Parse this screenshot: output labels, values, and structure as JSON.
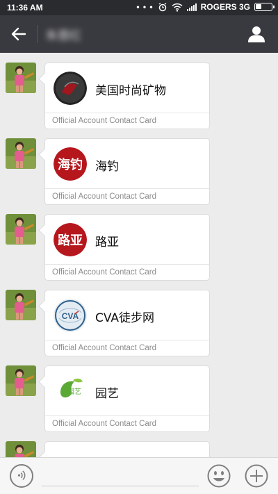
{
  "status_bar": {
    "time": "11:36 AM",
    "indicators": "• • •",
    "carrier": "ROGERS 3G",
    "icons": [
      "alarm-icon",
      "wifi-icon",
      "signal-icon",
      "battery-icon"
    ]
  },
  "header": {
    "title": "朱蓉红",
    "back_icon": "back-arrow-icon",
    "contact_icon": "contact-info-icon"
  },
  "messages": [
    {
      "name": "美国时尚矿物",
      "footer": "Official Account Contact Card",
      "logo": "dark-round-logo"
    },
    {
      "name": "海钓",
      "footer": "Official Account Contact Card",
      "logo": "red-seal-logo"
    },
    {
      "name": "路亚",
      "footer": "Official Account Contact Card",
      "logo": "red-seal-logo"
    },
    {
      "name": "CVA徒步网",
      "footer": "Official Account Contact Card",
      "logo": "cva-globe-logo"
    },
    {
      "name": "园艺",
      "footer": "Official Account Contact Card",
      "logo": "green-leaf-logo"
    },
    {
      "name": "",
      "footer": "",
      "logo": "partial-logo"
    }
  ],
  "logo_text": {
    "m2": "海钓",
    "m3": "路亚",
    "m4": "CVA",
    "m5": "园艺"
  },
  "colors": {
    "status_bar": "#2a2b2f",
    "nav_bar": "#393a3f",
    "chat_bg": "#ececec",
    "seal_red": "#b5171d",
    "cva_blue": "#2e5f8a",
    "leaf_green": "#5aa935"
  },
  "input_bar": {
    "voice_icon": "voice-icon",
    "emoji_icon": "emoji-icon",
    "plus_icon": "plus-icon"
  }
}
